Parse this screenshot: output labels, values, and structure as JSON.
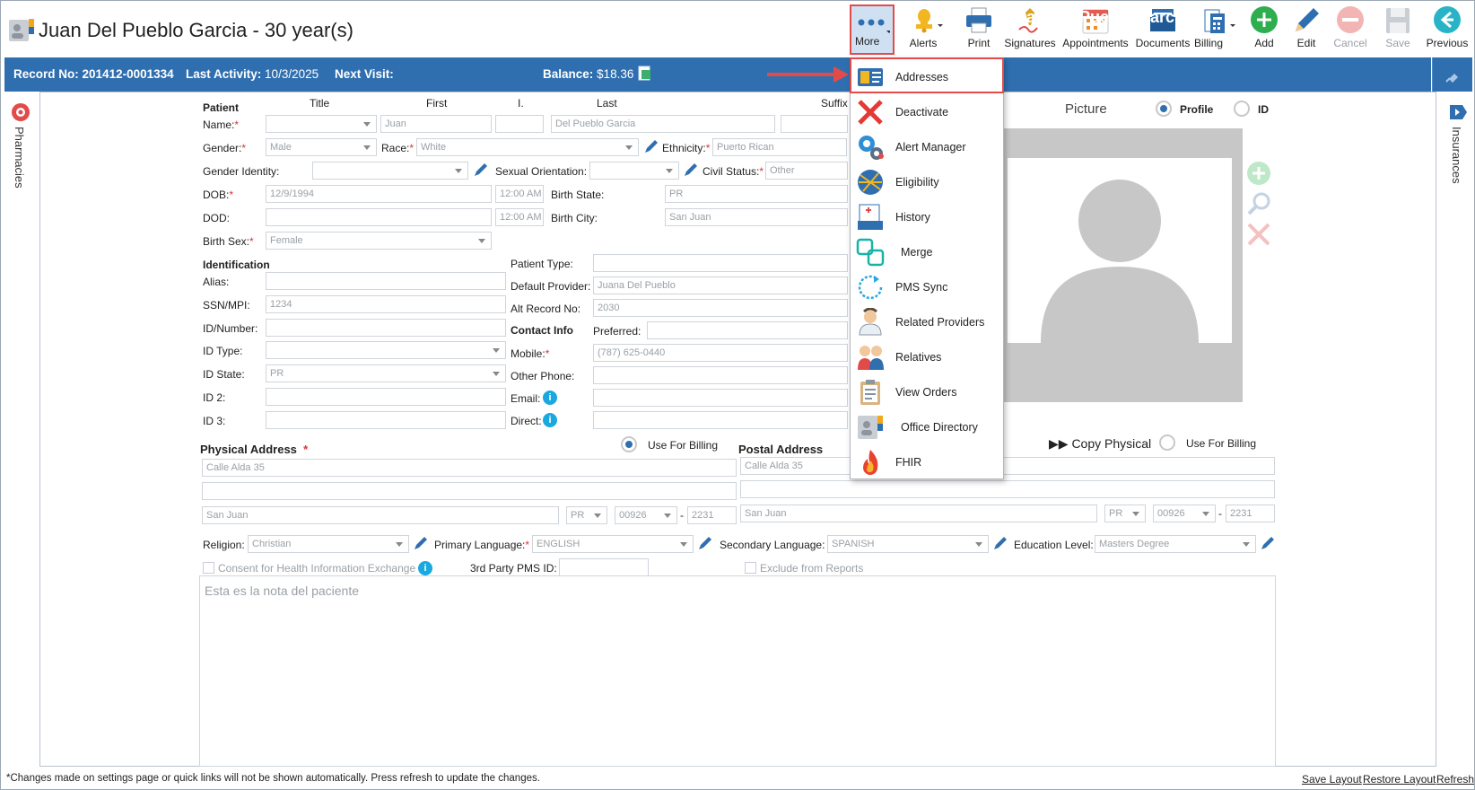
{
  "header": {
    "title": "Juan Del Pueblo Garcia - 30 year(s)"
  },
  "toolbar": {
    "more": "More",
    "alerts": "Alerts",
    "print": "Print",
    "signatures": "Signatures",
    "appointments": "Appointments",
    "documents": "Documents",
    "billing": "Billing",
    "add": "Add",
    "edit": "Edit",
    "cancel": "Cancel",
    "save": "Save",
    "previous": "Previous"
  },
  "infobar": {
    "record_label": "Record No:",
    "record_value": "201412-0001334",
    "activity_label": "Last Activity:",
    "activity_value": "10/3/2025",
    "visit_label": "Next Visit:",
    "balance_label": "Balance:",
    "balance_value": "$18.36",
    "name": "Juan Del Pueblo Garcia",
    "close": "×"
  },
  "sidetabs": {
    "left": "Pharmacies",
    "right": "Insurances"
  },
  "menu": {
    "items": [
      "Addresses",
      "Deactivate",
      "Alert Manager",
      "Eligibility",
      "History",
      "Merge",
      "PMS Sync",
      "Related Providers",
      "Relatives",
      "View Orders",
      "Office Directory",
      "FHIR"
    ]
  },
  "form": {
    "patient": "Patient",
    "title_col": "Title",
    "first_col": "First",
    "mi_col": "I.",
    "last_col": "Last",
    "suffix_col": "Suffix",
    "name_label": "Name:",
    "first": "Juan",
    "last": "Del Pueblo Garcia",
    "gender_label": "Gender:",
    "gender": "Male",
    "race_label": "Race:",
    "race": "White",
    "ethnicity_label": "Ethnicity:",
    "ethnicity": "Puerto Rican",
    "gender_identity_label": "Gender Identity:",
    "sexual_orientation_label": "Sexual Orientation:",
    "civil_status_label": "Civil Status:",
    "civil_status": "Other",
    "dob_label": "DOB:",
    "dob": "12/9/1994",
    "time": "12:00 AM",
    "birth_state_label": "Birth State:",
    "birth_state": "PR",
    "dod_label": "DOD:",
    "birth_city_label": "Birth City:",
    "birth_city": "San Juan",
    "birth_sex_label": "Birth Sex:",
    "birth_sex": "Female",
    "identification": "Identification",
    "patient_type_label": "Patient Type:",
    "alias_label": "Alias:",
    "default_provider_label": "Default Provider:",
    "default_provider": "Juana Del Pueblo",
    "ssn_label": "SSN/MPI:",
    "ssn": "1234",
    "alt_record_label": "Alt Record No:",
    "alt_record": "2030",
    "id_number_label": "ID/Number:",
    "contact_info": "Contact Info",
    "preferred_label": "Preferred:",
    "id_type_label": "ID Type:",
    "mobile_label": "Mobile:",
    "mobile": "(787) 625-0440",
    "id_state_label": "ID State:",
    "id_state": "PR",
    "other_phone_label": "Other Phone:",
    "id2_label": "ID 2:",
    "email_label": "Email:",
    "id3_label": "ID 3:",
    "direct_label": "Direct:",
    "physical_address": "Physical Address",
    "use_for_billing": "Use For Billing",
    "postal_address": "Postal Address",
    "copy_physical": "Copy Physical",
    "phys_street": "Calle Alda 35",
    "phys_city": "San Juan",
    "phys_state": "PR",
    "phys_zip": "00926",
    "phys_zip4": "2231",
    "postal_street": "Calle Alda 35",
    "postal_city": "San Juan",
    "postal_state": "PR",
    "postal_zip": "00926",
    "postal_zip4": "2231",
    "dash": "-",
    "religion_label": "Religion:",
    "religion": "Christian",
    "primary_language_label": "Primary Language:",
    "primary_language": "ENGLISH",
    "secondary_language_label": "Secondary Language:",
    "secondary_language": "SPANISH",
    "education_label": "Education Level:",
    "education": "Masters Degree",
    "consent_label": "Consent for Health Information Exchange",
    "pms_id_label": "3rd Party PMS ID:",
    "exclude_label": "Exclude from Reports",
    "notes": "Esta es la nota del paciente"
  },
  "picture": {
    "label": "Picture",
    "profile": "Profile",
    "id": "ID"
  },
  "footer": {
    "note": "*Changes made on settings page or quick links will not be shown automatically. Press refresh to update the changes.",
    "save_layout": "Save Layout",
    "restore_layout": "Restore Layout",
    "refresh": "Refresh"
  },
  "colors": {
    "accent": "#2f6fb0",
    "highlight": "#e34b4b"
  }
}
